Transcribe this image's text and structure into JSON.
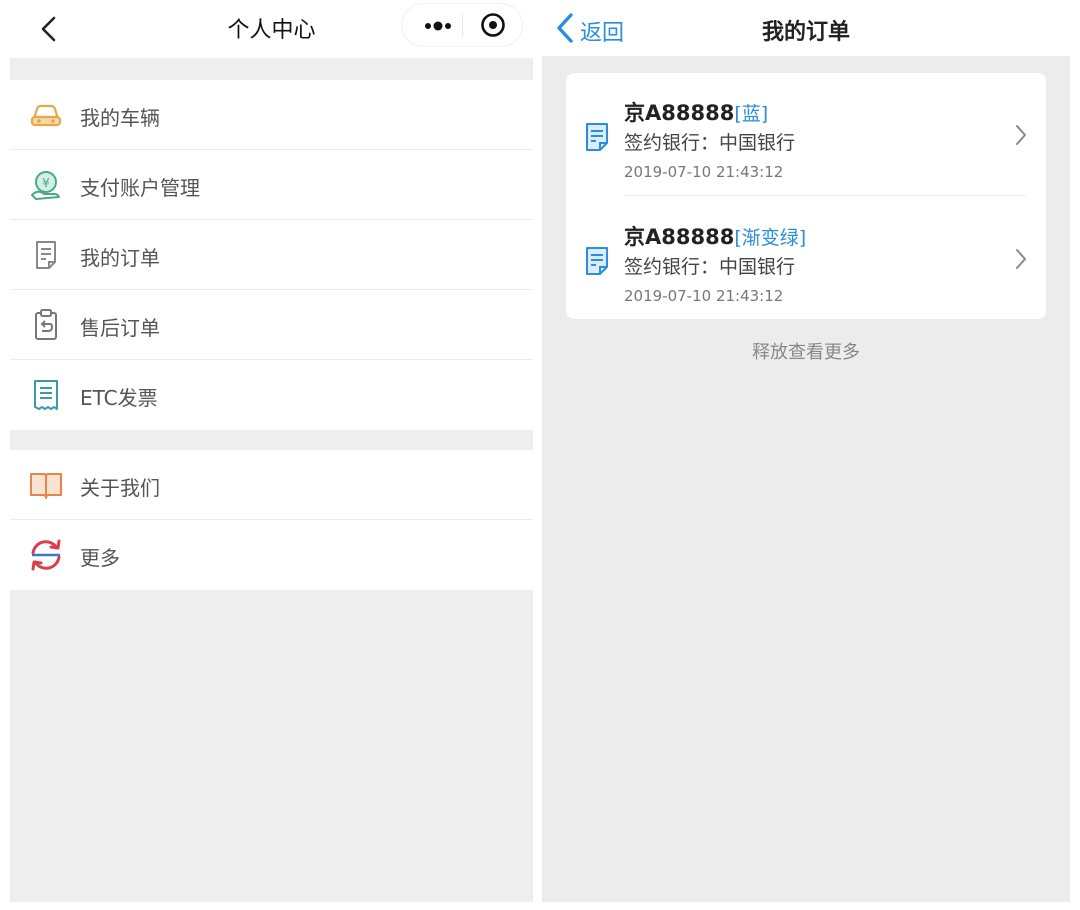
{
  "left": {
    "header": {
      "title": "个人中心"
    },
    "group1": [
      {
        "label": "我的车辆",
        "icon": "car-icon"
      },
      {
        "label": "支付账户管理",
        "icon": "payment-account-icon"
      },
      {
        "label": "我的订单",
        "icon": "order-document-icon"
      },
      {
        "label": "售后订单",
        "icon": "after-sales-clipboard-icon"
      },
      {
        "label": "ETC发票",
        "icon": "invoice-receipt-icon"
      }
    ],
    "group2": [
      {
        "label": "关于我们",
        "icon": "open-book-icon"
      },
      {
        "label": "更多",
        "icon": "refresh-cycle-icon"
      }
    ]
  },
  "right": {
    "header": {
      "back_label": "返回",
      "title": "我的订单"
    },
    "orders": [
      {
        "plate": "京A88888",
        "tag": "[蓝]",
        "bank": "签约银行：中国银行",
        "time": "2019-07-10   21:43:12"
      },
      {
        "plate": "京A88888",
        "tag": "[渐变绿]",
        "bank": "签约银行：中国银行",
        "time": "2019-07-10   21:43:12"
      }
    ],
    "load_more": "释放查看更多"
  },
  "colors": {
    "accent_blue": "#2a8ee0",
    "car_orange": "#e8a84a",
    "pay_green": "#4aa88a",
    "book_orange": "#e8834a",
    "cycle_red": "#d9404a",
    "cycle_blue": "#3a78c8"
  }
}
